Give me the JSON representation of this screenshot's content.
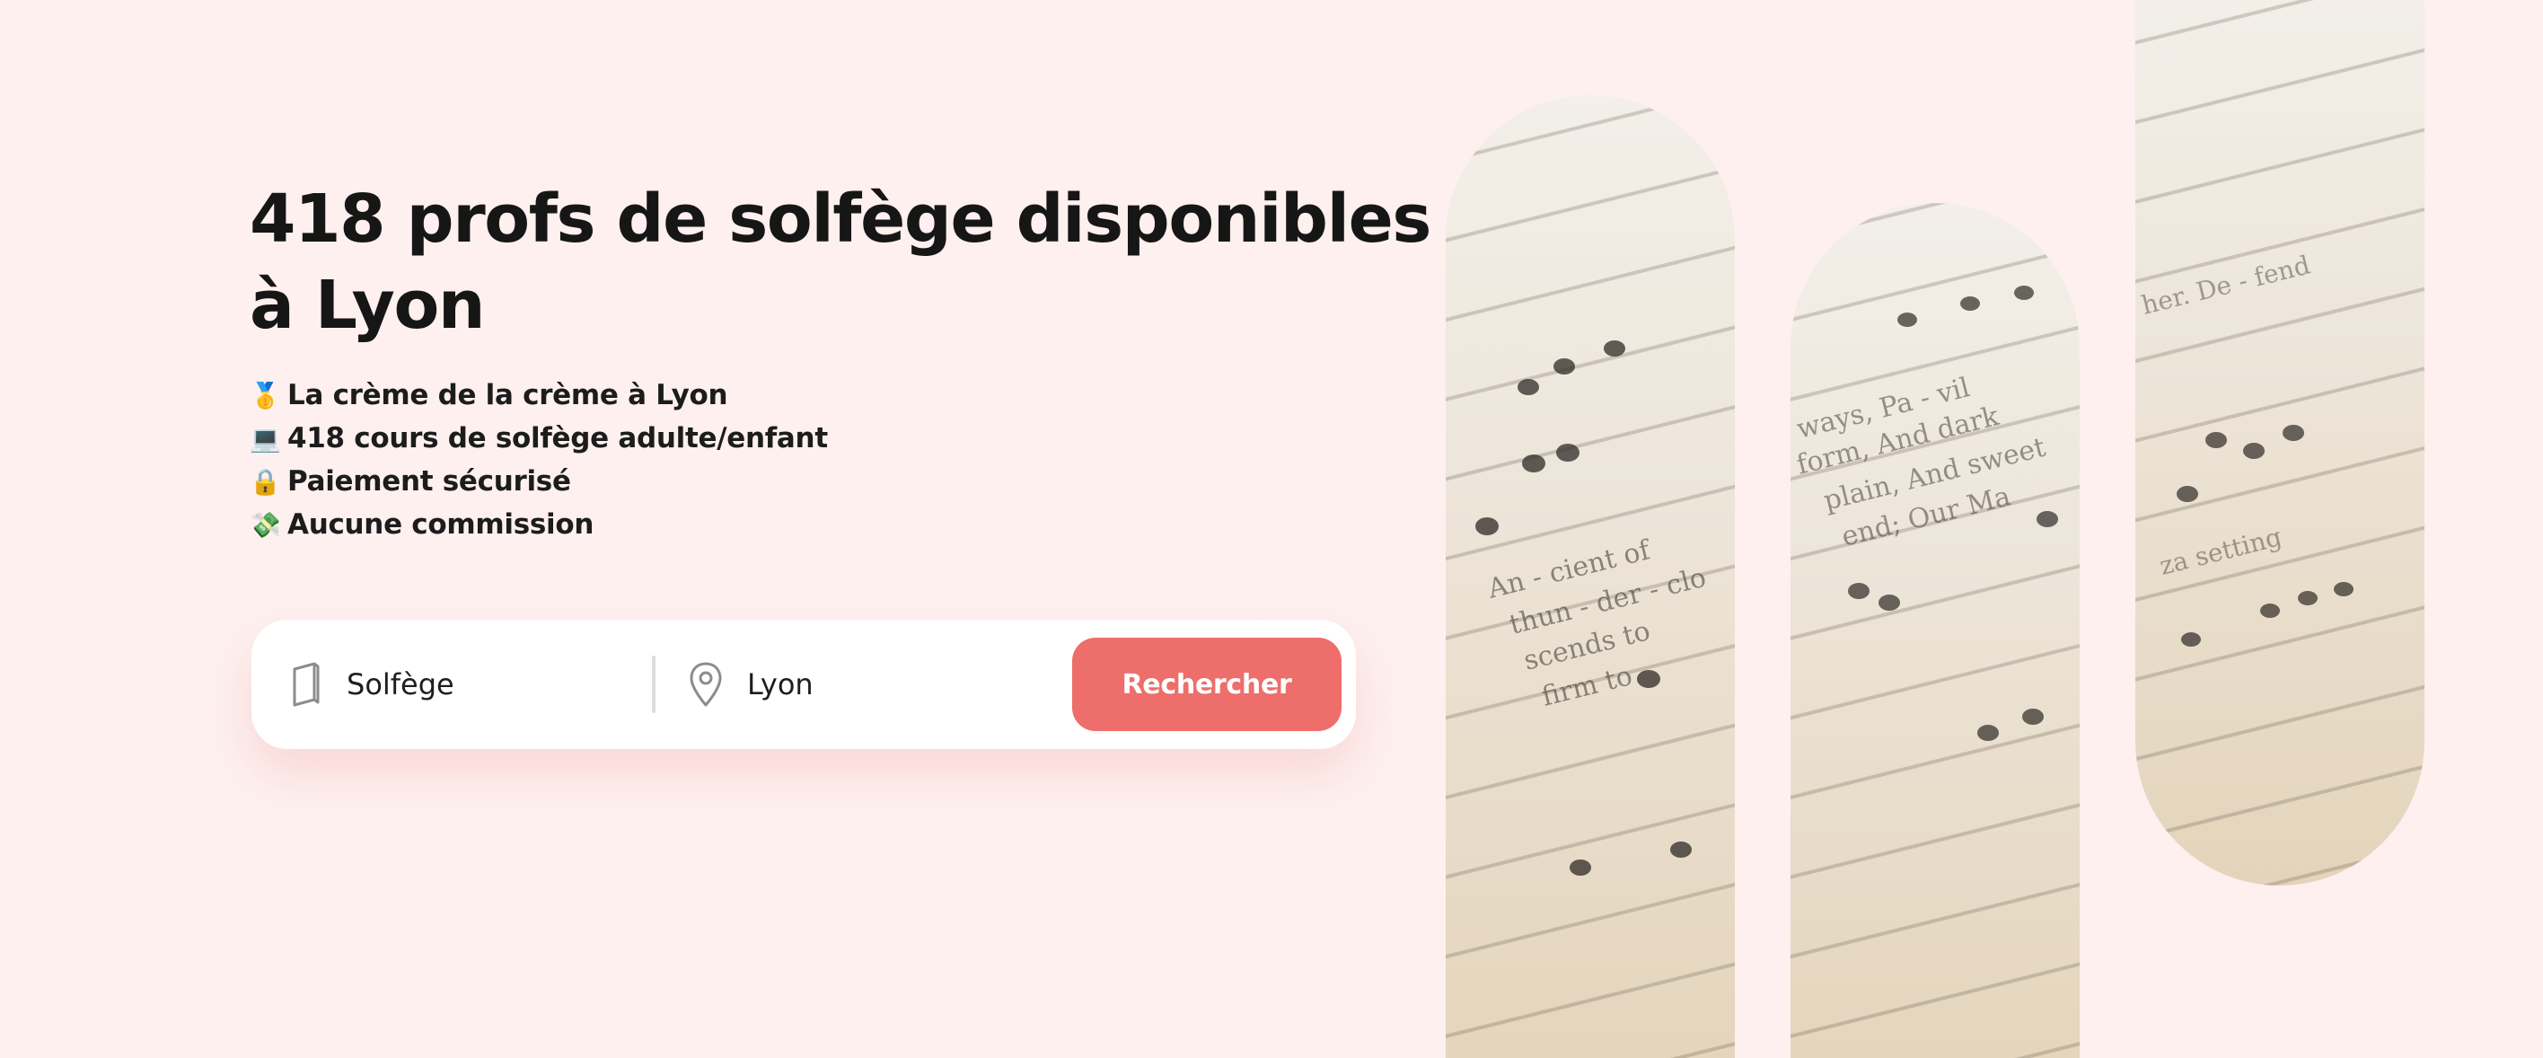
{
  "hero": {
    "title": "418 profs de solfège disponibles à Lyon"
  },
  "features": [
    {
      "icon": "🥇",
      "text": "La crème de la crème à Lyon"
    },
    {
      "icon": "💻",
      "text": "418 cours de solfège adulte/enfant"
    },
    {
      "icon": "🔒",
      "text": "Paiement sécurisé"
    },
    {
      "icon": "💸",
      "text": "Aucune commission"
    }
  ],
  "search": {
    "subject_value": "Solfège",
    "subject_icon": "book-icon",
    "city_value": "Lyon",
    "city_icon": "location-pin-icon",
    "button_label": "Rechercher"
  },
  "images": {
    "pill_photo_subject": "sheet-music-photo"
  },
  "colors": {
    "background": "#fdf0ef",
    "accent": "#ed6e6a",
    "text": "#161616"
  }
}
